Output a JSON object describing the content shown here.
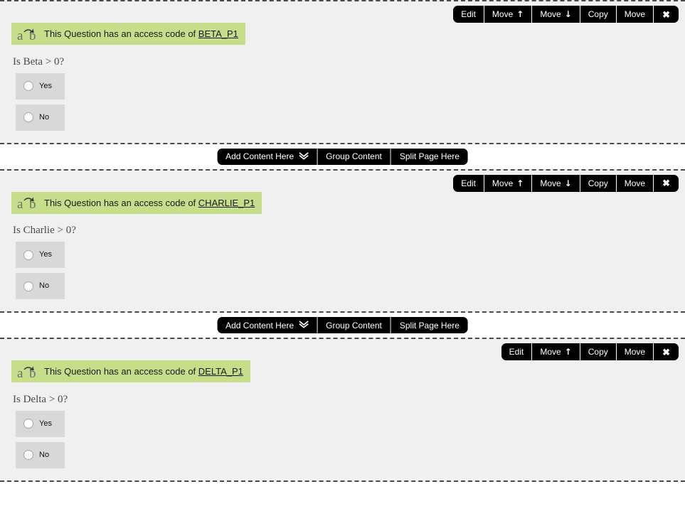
{
  "blocks": [
    {
      "toolbar": {
        "buttons": [
          {
            "label": "Edit",
            "icon": ""
          },
          {
            "label": "Move",
            "icon": "up-arrow-icon"
          },
          {
            "label": "Move",
            "icon": "down-arrow-icon"
          },
          {
            "label": "Copy",
            "icon": ""
          },
          {
            "label": "Move",
            "icon": ""
          }
        ],
        "close_label": "✖"
      },
      "banner": {
        "icon": "a-to-b-icon",
        "prefix": "This Question has an access code of ",
        "code": "BETA_P1"
      },
      "question": "Is Beta > 0?",
      "choices": [
        {
          "label": "Yes"
        },
        {
          "label": "No"
        }
      ]
    },
    {
      "toolbar": {
        "buttons": [
          {
            "label": "Edit",
            "icon": ""
          },
          {
            "label": "Move",
            "icon": "up-arrow-icon"
          },
          {
            "label": "Move",
            "icon": "down-arrow-icon"
          },
          {
            "label": "Copy",
            "icon": ""
          },
          {
            "label": "Move",
            "icon": ""
          }
        ],
        "close_label": "✖"
      },
      "banner": {
        "icon": "a-to-b-icon",
        "prefix": "This Question has an access code of ",
        "code": "CHARLIE_P1"
      },
      "question": "Is Charlie > 0?",
      "choices": [
        {
          "label": "Yes"
        },
        {
          "label": "No"
        }
      ]
    },
    {
      "toolbar": {
        "buttons": [
          {
            "label": "Edit",
            "icon": ""
          },
          {
            "label": "Move",
            "icon": "up-arrow-icon"
          },
          {
            "label": "Copy",
            "icon": ""
          },
          {
            "label": "Move",
            "icon": ""
          }
        ],
        "close_label": "✖"
      },
      "banner": {
        "icon": "a-to-b-icon",
        "prefix": "This Question has an access code of ",
        "code": "DELTA_P1"
      },
      "question": "Is Delta > 0?",
      "choices": [
        {
          "label": "Yes"
        },
        {
          "label": "No"
        }
      ]
    }
  ],
  "action_bars": [
    {
      "add_content_label": "Add Content Here",
      "add_content_icon": "double-chevron-down-icon",
      "group_content_label": "Group Content",
      "split_page_label": "Split Page Here"
    },
    {
      "add_content_label": "Add Content Here",
      "add_content_icon": "double-chevron-down-icon",
      "group_content_label": "Group Content",
      "split_page_label": "Split Page Here"
    }
  ],
  "colors": {
    "block_background": "#f0f0f0",
    "banner_green": "#c6de89",
    "toolbar_black": "#000000",
    "choice_gray": "#d8d8d8",
    "page_background": "#ffffff",
    "dashed_border": "#4a4a4a"
  },
  "icon_glyphs": {
    "up_arrow": "↑",
    "down_arrow": "↓",
    "double_chevron_down": "»",
    "close": "✖"
  }
}
